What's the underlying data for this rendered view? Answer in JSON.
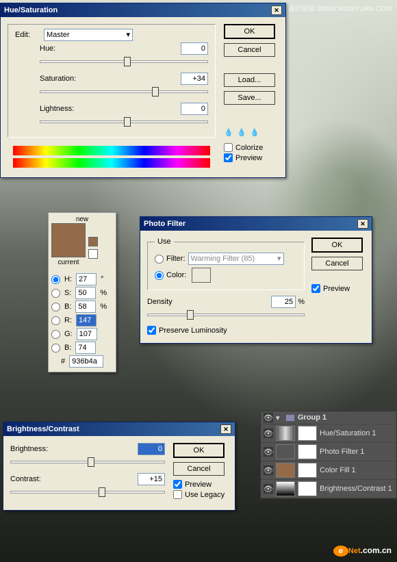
{
  "watermark": "思缘设计论坛 WWW.MISSYUAN.COM",
  "hs": {
    "title": "Hue/Saturation",
    "editLabel": "Edit:",
    "editValue": "Master",
    "hueLabel": "Hue:",
    "hueValue": "0",
    "satLabel": "Saturation:",
    "satValue": "+34",
    "lightLabel": "Lightness:",
    "lightValue": "0",
    "ok": "OK",
    "cancel": "Cancel",
    "load": "Load...",
    "save": "Save...",
    "colorize": "Colorize",
    "preview": "Preview"
  },
  "color": {
    "new": "new",
    "current": "current",
    "h": "27",
    "s": "50",
    "b": "58",
    "r": "147",
    "g": "107",
    "bl": "74",
    "hex": "936b4a",
    "swatch": "#936b4a",
    "hL": "H:",
    "sL": "S:",
    "bL": "B:",
    "rL": "R:",
    "gL": "G:",
    "blL": "B:",
    "deg": "°",
    "pct": "%",
    "hash": "#"
  },
  "pf": {
    "title": "Photo Filter",
    "useLegend": "Use",
    "filterLabel": "Filter:",
    "filterValue": "Warming Filter (85)",
    "colorLabel": "Color:",
    "swatch": "#c08a3a",
    "densityLabel": "Density",
    "densityValue": "25",
    "pct": "%",
    "preserve": "Preserve Luminosity",
    "ok": "OK",
    "cancel": "Cancel",
    "preview": "Preview"
  },
  "bc": {
    "title": "Brightness/Contrast",
    "brightLabel": "Brightness:",
    "brightValue": "0",
    "contrastLabel": "Contrast:",
    "contrastValue": "+15",
    "ok": "OK",
    "cancel": "Cancel",
    "preview": "Preview",
    "legacy": "Use Legacy"
  },
  "layers": {
    "group": "Group 1",
    "items": [
      "Hue/Saturation 1",
      "Photo Filter 1",
      "Color Fill 1",
      "Brightness/Contrast 1"
    ]
  },
  "logo": {
    "e": "e",
    "net": "Net",
    "com": ".com.cn"
  }
}
